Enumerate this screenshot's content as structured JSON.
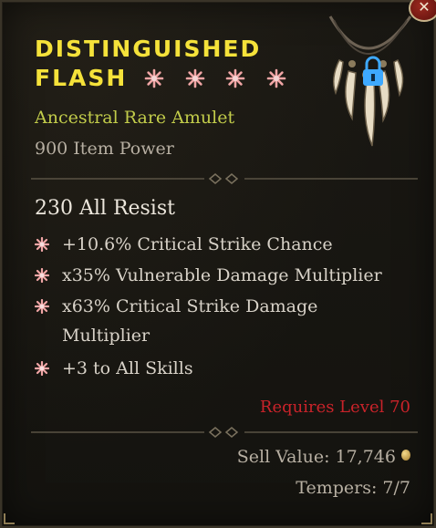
{
  "item": {
    "name_line1": "DISTINGUISHED",
    "name_line2": "FLASH",
    "rarity_type": "Ancestral Rare Amulet",
    "item_power": "900 Item Power",
    "base_stat": "230 All Resist",
    "affixes": [
      {
        "text": "+10.6% Critical Strike Chance"
      },
      {
        "text": "x35% Vulnerable Damage Multiplier"
      },
      {
        "text": "x63% Critical Strike Damage Multiplier"
      },
      {
        "text": "+3 to All Skills"
      }
    ],
    "requirement": "Requires Level 70",
    "sell_value": "Sell Value: 17,746",
    "tempers": "Tempers: 7/7",
    "star_count": 4
  },
  "icons": {
    "close": "close-icon",
    "lock": "lock-icon",
    "star": "star-icon",
    "bullet": "affix-bullet-icon",
    "coin": "gold-coin-icon"
  },
  "colors": {
    "title": "#f5e23a",
    "rarity": "#c2cc4a",
    "requirement": "#c9232a",
    "bullet": "#f0a5a5",
    "lock": "#3ea9ff"
  }
}
